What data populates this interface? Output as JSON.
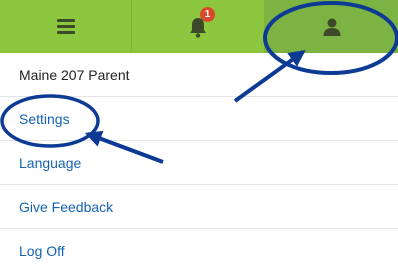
{
  "header": {
    "notifications_count": "1"
  },
  "menu": {
    "items": [
      {
        "label": "Maine 207 Parent"
      },
      {
        "label": "Settings"
      },
      {
        "label": "Language"
      },
      {
        "label": "Give Feedback"
      },
      {
        "label": "Log Off"
      }
    ]
  },
  "colors": {
    "topbar": "#8dc63f",
    "topbar_active": "#7cb342",
    "link": "#1463b3",
    "badge": "#d9482b",
    "annotation": "#0d3a94"
  },
  "icons": {
    "menu": "hamburger-icon",
    "notifications": "bell-icon",
    "user": "user-icon"
  }
}
